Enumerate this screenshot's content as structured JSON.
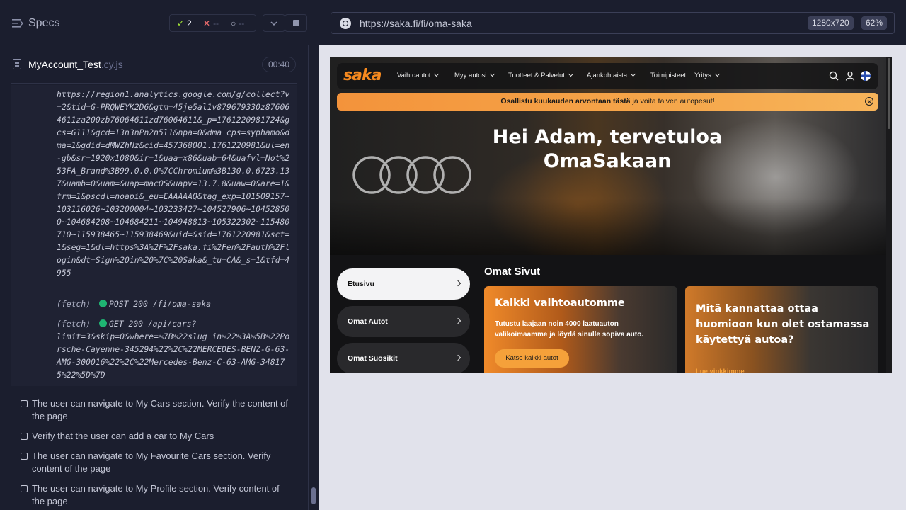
{
  "runner": {
    "specs_title": "Specs",
    "stats": {
      "passed": "2",
      "failed": "--",
      "pending": "--"
    },
    "file": {
      "name": "MyAccount_Test",
      "ext": ".cy.js",
      "duration": "00:40"
    },
    "log": {
      "url": "https://region1.analytics.google.com/g/collect?v=2&tid=G-PRQWEYK2D6&gtm=45je5al1v879679330z876064611za200zb76064611zd76064611&_p=1761220981724&gcs=G111&gcd=13n3nPn2n5l1&npa=0&dma_cps=syphamo&dma=1&gdid=dMWZhNz&cid=457368001.1761220981&ul=en-gb&sr=1920x1080&ir=1&uaa=x86&uab=64&uafvl=Not%253FA_Brand%3B99.0.0.0%7CChromium%3B130.0.6723.137&uamb=0&uam=&uap=macOS&uapv=13.7.8&uaw=0&are=1&frm=1&pscdl=noapi&_eu=EAAAAAQ&tag_exp=101509157~103116026~103200004~103233427~104527906~104528500~104684208~104684211~104948813~105322302~115480710~115938465~115938469&uid=&sid=1761220981&sct=1&seg=1&dl=https%3A%2F%2Fsaka.fi%2Fen%2Fauth%2Flogin&dt=Sign%20in%20%7C%20Saka&_tu=CA&_s=1&tfd=4955",
      "fetch1": {
        "label": "(fetch)",
        "text": "POST 200 /fi/oma-saka"
      },
      "fetch2": {
        "label": "(fetch)",
        "first": "GET 200 /api/cars?",
        "rest": "limit=3&skip=0&where=%7B%22slug_in%22%3A%5B%22Porsche-Cayenne-345294%22%2C%22MERCEDES-BENZ-G-63-AMG-300016%22%2C%22Mercedes-Benz-C-63-AMG-348175%22%5D%7D"
      }
    },
    "tests": [
      "The user can navigate to My Cars section. Verify the content of the page",
      "Verify that the user can add a car to My Cars",
      "The user can navigate to My Favourite Cars section. Verify content of the page",
      "The user can navigate to My Profile section. Verify content of the page"
    ]
  },
  "preview": {
    "url": "https://saka.fi/fi/oma-saka",
    "viewport": "1280x720",
    "zoom": "62%"
  },
  "site": {
    "logo": "saka",
    "nav": [
      {
        "label": "Vaihtoautot",
        "dropdown": true
      },
      {
        "label": "Myy autosi",
        "dropdown": true
      },
      {
        "label": "Tuotteet & Palvelut",
        "dropdown": true
      },
      {
        "label": "Ajankohtaista",
        "dropdown": true
      },
      {
        "label": "Toimipisteet",
        "dropdown": false
      },
      {
        "label": "Yritys",
        "dropdown": true
      }
    ],
    "banner": {
      "bold": "Osallistu kuukauden arvontaan tästä",
      "rest": " ja voita talven autopesut!"
    },
    "hero_line1": "Hei Adam, tervetuloa",
    "hero_line2": "OmaSakaan",
    "sidebar": [
      "Etusivu",
      "Omat Autot",
      "Omat Suosikit"
    ],
    "section_title": "Omat Sivut",
    "card1": {
      "title": "Kaikki vaihtoautomme",
      "desc": "Tutustu laajaan noin 4000 laatuauton valikoimaamme ja löydä sinulle sopiva auto.",
      "button": "Katso kaikki autot"
    },
    "card2": {
      "title": "Mitä kannattaa ottaa huomioon kun olet ostamassa käytettyä autoa?",
      "link": "Lue vinkkimme"
    },
    "colors": {
      "accent": "#f5891f",
      "banner": "#f3933b",
      "runner_bg": "#1b1e2e",
      "pass": "#a3e635",
      "fail": "#f87171"
    }
  }
}
